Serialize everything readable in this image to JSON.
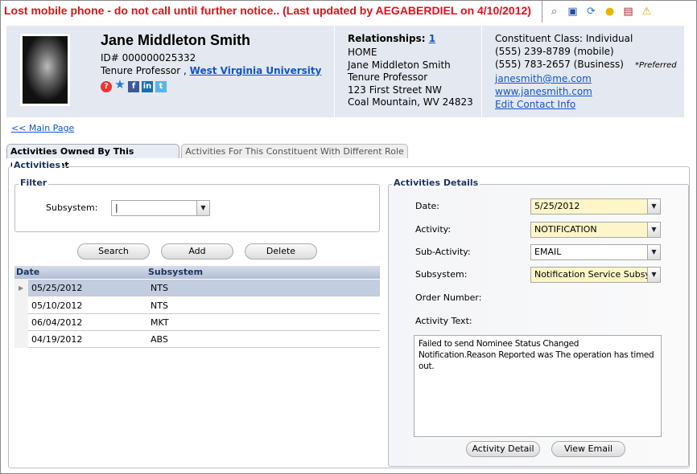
{
  "alert": "Lost mobile phone - do not call until further notice.. (Last updated by AEGABERDIEL on 4/10/2012)",
  "toolbar": [
    "binoculars-icon",
    "save-icon",
    "refresh-icon",
    "lightbulb-icon",
    "report-icon",
    "warning-icon"
  ],
  "profile": {
    "name": "Jane Middleton Smith",
    "id": "ID# 000000025332",
    "title": "Tenure Professor ,",
    "org": "West Virginia University"
  },
  "relationships": {
    "label": "Relationships:",
    "count": "1",
    "lines": [
      "HOME",
      "Jane Middleton Smith",
      "Tenure Professor",
      "123 First Street NW",
      "Coal Mountain, WV 24823"
    ]
  },
  "contact": {
    "class": "Constituent Class: Individual",
    "phone1": "(555) 239-8789 (mobile)",
    "phone2": "(555) 783-2657 (Business)",
    "preferred": "*Preferred",
    "email": "janesmith@me.com",
    "web": "www.janesmith.com",
    "edit": "Edit Contact Info"
  },
  "nav": {
    "main": "<< Main Page"
  },
  "tabs": [
    "Activities Owned By This Constituent",
    "Activities For This Constituent With Different Role"
  ],
  "activities": {
    "legend": "Activities",
    "filter": {
      "legend": "Filter",
      "subsystem_label": "Subsystem:",
      "subsystem_value": ""
    },
    "buttons": {
      "search": "Search",
      "add": "Add",
      "delete": "Delete"
    },
    "columns": [
      "Date",
      "Subsystem"
    ],
    "rows": [
      [
        "05/25/2012",
        "NTS"
      ],
      [
        "05/10/2012",
        "NTS"
      ],
      [
        "06/04/2012",
        "MKT"
      ],
      [
        "04/19/2012",
        "ABS"
      ]
    ]
  },
  "details": {
    "legend": "Activities Details",
    "date_label": "Date:",
    "date": "5/25/2012",
    "activity_label": "Activity:",
    "activity": "NOTIFICATION",
    "sub_label": "Sub-Activity:",
    "sub": "EMAIL",
    "subsystem_label": "Subsystem:",
    "subsystem": "Notification Service Subsystem",
    "order_label": "Order Number:",
    "text_label": "Activity Text:",
    "text": "Failed to send Nominee Status Changed Notification.Reason Reported was The operation has timed out.",
    "detail_btn": "Activity Detail",
    "email_btn": "View Email"
  }
}
